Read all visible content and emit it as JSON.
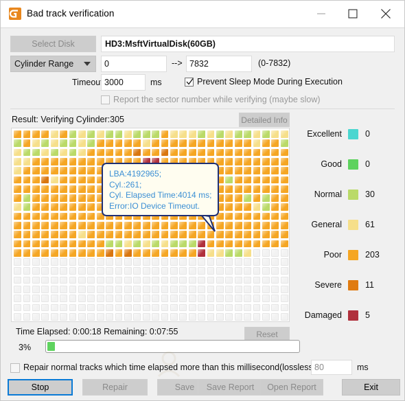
{
  "window": {
    "title": "Bad track verification",
    "icon": "app-logo-icon",
    "minimize": "minimize-icon",
    "maximize": "maximize-icon",
    "close": "close-icon"
  },
  "toolbar": {
    "select_disk_label": "Select Disk",
    "disk_name": "HD3:MsftVirtualDisk(60GB)",
    "range_mode": "Cylinder Range",
    "range_from": "0",
    "range_to": "7832",
    "range_arrow": "-->",
    "range_hint": "(0-7832)",
    "timeout_label": "Timeout:",
    "timeout_value": "3000",
    "timeout_unit": "ms",
    "prevent_sleep_label": "Prevent Sleep Mode During Execution",
    "prevent_sleep_checked": true,
    "report_sector_label": "Report the sector number while verifying (maybe slow)",
    "report_sector_checked": false
  },
  "result": {
    "label": "Result:  Verifying Cylinder:305",
    "detailed_info_label": "Detailed Info"
  },
  "tooltip": {
    "line1": "LBA:4192965;",
    "line2": "Cyl.:261;",
    "line3": "Cyl. Elapsed Time:4014 ms;",
    "line4": "Error:IO Device Timeout."
  },
  "legend": [
    {
      "name": "Excellent",
      "color": "#4ad6d0",
      "count": "0"
    },
    {
      "name": "Good",
      "color": "#5ed25e",
      "count": "0"
    },
    {
      "name": "Normal",
      "color": "#bada68",
      "count": "30"
    },
    {
      "name": "General",
      "color": "#f6df8a",
      "count": "61"
    },
    {
      "name": "Poor",
      "color": "#f5a623",
      "count": "203"
    },
    {
      "name": "Severe",
      "color": "#e07b10",
      "count": "11"
    },
    {
      "name": "Damaged",
      "color": "#b0303c",
      "count": "5"
    }
  ],
  "progress": {
    "time_label": "Time Elapsed:  0:00:18  Remaining:  0:07:55",
    "reset_label": "Reset",
    "percent_label": "3%",
    "percent_value": 3
  },
  "bottom": {
    "repair_checkbox_label": "Repair normal tracks which time elapsed more than this millisecond(lossless):",
    "repair_checkbox_checked": false,
    "repair_ms_value": "80",
    "repair_ms_unit": "ms",
    "buttons": {
      "stop": "Stop",
      "repair": "Repair",
      "save": "Save",
      "save_report": "Save Report",
      "open_report": "Open Report",
      "exit": "Exit"
    }
  },
  "grid": {
    "columns": 30,
    "rows": 21,
    "palette": {
      "empty": "#f2f2f2",
      "normal": "#bada68",
      "general": "#f6df8a",
      "poor": "#f5a623",
      "severe": "#d9760f",
      "damaged": "#b0303c"
    },
    "cells": [
      "PPPPGPNGNGNNGNNNPGGGNGNGNNGNGG",
      "NPGNGNNGNPPPPPGPPPPPPPPPPPGPPN",
      "GNNGNGNGPPPPPSPPSPPPPPPPPPPPPP",
      "GGPPPPPPPPPPPPDDPPPPPPPPPPPPPP",
      "GPPPPPPPPPPPPPPPPPPPPPPPPPPPPP",
      "PPPSGPPPPPPPPPPPPPPPPPPNPPPPPP",
      "PPPPPPPPPPPPPPPPPPPPPPPPPPPPPP",
      "PNPPPPPPPPPPPPPPPPPPPPPPPNPNPP",
      "GNPPPPPPPPPPPPPPPPPPPPPPPPGNPP",
      "PPPPPPPPPPPPPPPPPPPPPPPPPPPPPP",
      "PPPPPPPPPPPPPPPPPPPPPPPPPPPPPP",
      "PPPPPPPGPPPPPPPPPPPPPPPPPPPPPP",
      "PPPPPPPPPPNNGNGNGNNNDPPPPPPPPP",
      "PPPPPPPPPPSPSPPPPPPPDGGNNG...",
      "..............................",
      "..............................",
      "..............................",
      "..............................",
      "..............................",
      "..............................",
      ".............................."
    ]
  }
}
